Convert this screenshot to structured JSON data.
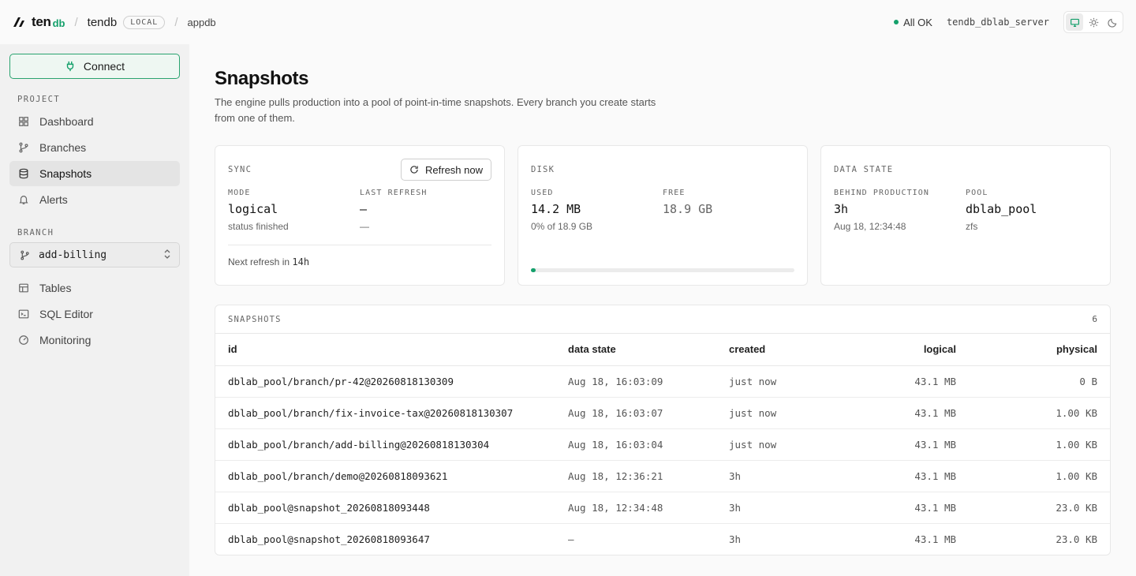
{
  "topbar": {
    "logo_ten": "ten",
    "logo_db": "db",
    "project": "tendb",
    "project_badge": "LOCAL",
    "database": "appdb",
    "status": "All OK",
    "server": "tendb_dblab_server",
    "theme_icons": [
      "monitor-icon",
      "sun-icon",
      "moon-icon"
    ]
  },
  "sidebar": {
    "connect_label": "Connect",
    "project_label": "PROJECT",
    "project_items": [
      {
        "label": "Dashboard",
        "icon": "grid-icon"
      },
      {
        "label": "Branches",
        "icon": "git-branch-icon"
      },
      {
        "label": "Snapshots",
        "icon": "database-icon",
        "active": true
      },
      {
        "label": "Alerts",
        "icon": "bell-icon"
      }
    ],
    "branch_label": "BRANCH",
    "branch_value": "add-billing",
    "branch_items": [
      {
        "label": "Tables",
        "icon": "table-icon"
      },
      {
        "label": "SQL Editor",
        "icon": "terminal-icon"
      },
      {
        "label": "Monitoring",
        "icon": "gauge-icon"
      }
    ]
  },
  "main": {
    "title": "Snapshots",
    "description": "The engine pulls production into a pool of point-in-time snapshots. Every branch you create starts from one of them."
  },
  "sync": {
    "label": "SYNC",
    "refresh_label": "Refresh now",
    "mode_label": "MODE",
    "mode_value": "logical",
    "mode_sub": "status finished",
    "last_refresh_label": "LAST REFRESH",
    "last_refresh_value": "—",
    "last_refresh_sub": "—",
    "next_prefix": "Next refresh in",
    "next_value": "14h"
  },
  "disk": {
    "label": "DISK",
    "used_label": "USED",
    "used_value": "14.2 MB",
    "used_sub": "0% of 18.9 GB",
    "free_label": "FREE",
    "free_value": "18.9 GB",
    "used_fraction": 0.0007
  },
  "data_state": {
    "label": "DATA STATE",
    "behind_label": "BEHIND PRODUCTION",
    "behind_value": "3h",
    "behind_sub": "Aug 18, 12:34:48",
    "pool_label": "POOL",
    "pool_value": "dblab_pool",
    "pool_sub": "zfs"
  },
  "snapshots": {
    "label": "SNAPSHOTS",
    "count": "6",
    "columns": {
      "id": "id",
      "data_state": "data state",
      "created": "created",
      "logical": "logical",
      "physical": "physical"
    },
    "rows": [
      {
        "id": "dblab_pool/branch/pr-42@20260818130309",
        "data_state": "Aug 18, 16:03:09",
        "created": "just now",
        "logical": "43.1 MB",
        "physical": "0 B"
      },
      {
        "id": "dblab_pool/branch/fix-invoice-tax@20260818130307",
        "data_state": "Aug 18, 16:03:07",
        "created": "just now",
        "logical": "43.1 MB",
        "physical": "1.00 KB"
      },
      {
        "id": "dblab_pool/branch/add-billing@20260818130304",
        "data_state": "Aug 18, 16:03:04",
        "created": "just now",
        "logical": "43.1 MB",
        "physical": "1.00 KB"
      },
      {
        "id": "dblab_pool/branch/demo@20260818093621",
        "data_state": "Aug 18, 12:36:21",
        "created": "3h",
        "logical": "43.1 MB",
        "physical": "1.00 KB"
      },
      {
        "id": "dblab_pool@snapshot_20260818093448",
        "data_state": "Aug 18, 12:34:48",
        "created": "3h",
        "logical": "43.1 MB",
        "physical": "23.0 KB"
      },
      {
        "id": "dblab_pool@snapshot_20260818093647",
        "data_state": "—",
        "created": "3h",
        "logical": "43.1 MB",
        "physical": "23.0 KB"
      }
    ]
  },
  "colors": {
    "accent": "#14a06b",
    "sidebar_bg": "#f1f1f1",
    "page_bg": "#fafafa"
  }
}
